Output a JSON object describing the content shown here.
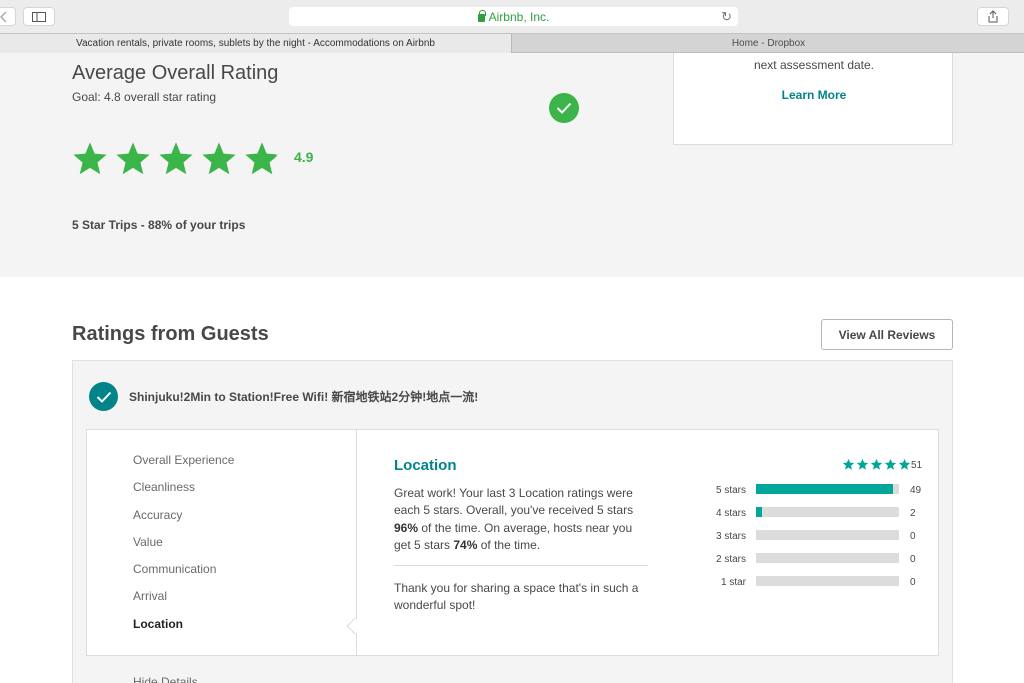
{
  "browser": {
    "url_text": "Airbnb, Inc.",
    "tabs": [
      {
        "label": "Vacation rentals, private rooms, sublets by the night - Accommodations on Airbnb"
      },
      {
        "label": "Home - Dropbox"
      }
    ],
    "icons": {
      "back": "chevron-left-icon",
      "sidebar": "sidebar-icon",
      "lock": "lock-icon",
      "reload": "reload-icon",
      "share": "share-icon"
    }
  },
  "overall": {
    "title": "Average Overall Rating",
    "goal": "Goal: 4.8 overall star rating",
    "rating": "4.9",
    "rating_value": 4.9,
    "five_star_trips": "5 Star Trips - 88% of your trips",
    "accent_color": "#3bb44a"
  },
  "assessment": {
    "text": "next assessment date.",
    "link": "Learn More"
  },
  "ratings": {
    "title": "Ratings from Guests",
    "view_all": "View All Reviews",
    "listing_title": "Shinjuku!2Min to Station!Free Wifi! 新宿地铁站2分钟!地点一流!",
    "categories": [
      {
        "label": "Overall Experience"
      },
      {
        "label": "Cleanliness"
      },
      {
        "label": "Accuracy"
      },
      {
        "label": "Value"
      },
      {
        "label": "Communication"
      },
      {
        "label": "Arrival"
      },
      {
        "label": "Location"
      }
    ],
    "selected": {
      "title": "Location",
      "text_1": "Great work! Your last 3 Location ratings were each 5 stars. Overall, you've received 5 stars ",
      "pct_you": "96%",
      "text_2": " of the time. On average, hosts near you get 5 stars ",
      "pct_hosts": "74%",
      "text_3": " of the time.",
      "thanks": "Thank you for sharing a space that's in such a wonderful spot!",
      "total": "51",
      "star_count": 5
    },
    "breakdown": [
      {
        "label": "5 stars",
        "count": "49",
        "fraction": 0.96
      },
      {
        "label": "4 stars",
        "count": "2",
        "fraction": 0.04
      },
      {
        "label": "3 stars",
        "count": "0",
        "fraction": 0
      },
      {
        "label": "2 stars",
        "count": "0",
        "fraction": 0
      },
      {
        "label": "1 star",
        "count": "0",
        "fraction": 0
      }
    ],
    "bar_color": "#00a699",
    "hide_details": "Hide Details"
  }
}
